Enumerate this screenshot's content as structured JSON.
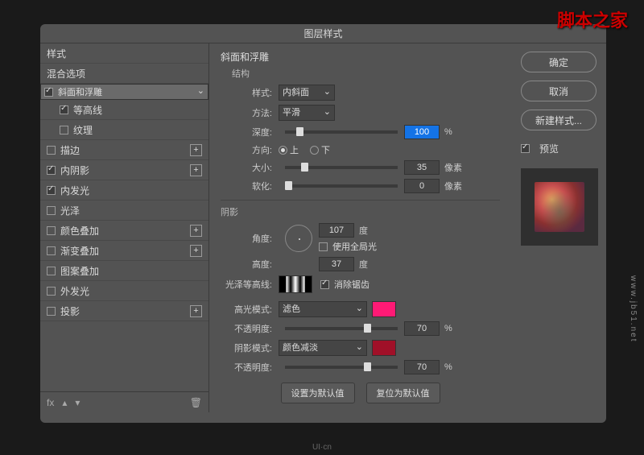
{
  "watermarks": {
    "w1": "脚本之家",
    "w2": "www.jb51.net"
  },
  "dialog": {
    "title": "图层样式"
  },
  "sidebar": {
    "items": [
      {
        "label": "样式",
        "cb": false,
        "plus": false,
        "sel": false,
        "indent": false
      },
      {
        "label": "混合选项",
        "cb": false,
        "plus": false,
        "sel": false,
        "indent": false
      },
      {
        "label": "斜面和浮雕",
        "cb": true,
        "on": true,
        "plus": false,
        "sel": true,
        "indent": false
      },
      {
        "label": "等高线",
        "cb": true,
        "on": true,
        "plus": false,
        "sel": false,
        "indent": true
      },
      {
        "label": "纹理",
        "cb": true,
        "on": false,
        "plus": false,
        "sel": false,
        "indent": true
      },
      {
        "label": "描边",
        "cb": true,
        "on": false,
        "plus": true,
        "sel": false,
        "indent": false
      },
      {
        "label": "内阴影",
        "cb": true,
        "on": true,
        "plus": true,
        "sel": false,
        "indent": false
      },
      {
        "label": "内发光",
        "cb": true,
        "on": true,
        "plus": false,
        "sel": false,
        "indent": false
      },
      {
        "label": "光泽",
        "cb": true,
        "on": false,
        "plus": false,
        "sel": false,
        "indent": false
      },
      {
        "label": "颜色叠加",
        "cb": true,
        "on": false,
        "plus": true,
        "sel": false,
        "indent": false
      },
      {
        "label": "渐变叠加",
        "cb": true,
        "on": false,
        "plus": true,
        "sel": false,
        "indent": false
      },
      {
        "label": "图案叠加",
        "cb": true,
        "on": false,
        "plus": false,
        "sel": false,
        "indent": false
      },
      {
        "label": "外发光",
        "cb": true,
        "on": false,
        "plus": false,
        "sel": false,
        "indent": false
      },
      {
        "label": "投影",
        "cb": true,
        "on": false,
        "plus": true,
        "sel": false,
        "indent": false
      }
    ],
    "fx": "fx"
  },
  "main": {
    "heading": "斜面和浮雕",
    "structure": "结构",
    "style_l": "样式:",
    "style_v": "内斜面",
    "method_l": "方法:",
    "method_v": "平滑",
    "depth_l": "深度:",
    "depth_v": "100",
    "pct": "%",
    "dir_l": "方向:",
    "up": "上",
    "down": "下",
    "size_l": "大小:",
    "size_v": "35",
    "px": "像素",
    "soft_l": "软化:",
    "soft_v": "0",
    "shading": "阴影",
    "angle_l": "角度:",
    "angle_v": "107",
    "deg": "度",
    "global": "使用全局光",
    "alt_l": "高度:",
    "alt_v": "37",
    "gloss_l": "光泽等高线:",
    "aa": "消除锯齿",
    "hmode_l": "高光模式:",
    "hmode_v": "滤色",
    "hcolor": "#ff1a75",
    "hop_l": "不透明度:",
    "hop_v": "70",
    "smode_l": "阴影模式:",
    "smode_v": "颜色减淡",
    "scolor": "#a01028",
    "sop_l": "不透明度:",
    "sop_v": "70",
    "def1": "设置为默认值",
    "def2": "复位为默认值"
  },
  "right": {
    "ok": "确定",
    "cancel": "取消",
    "new": "新建样式...",
    "preview": "预览"
  }
}
